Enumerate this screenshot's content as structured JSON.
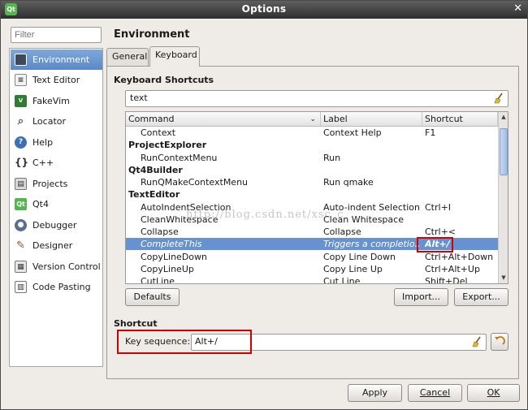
{
  "window": {
    "title": "Options"
  },
  "filter": {
    "placeholder": "Filter"
  },
  "sidebar": {
    "items": [
      {
        "label": "Environment",
        "icon": "monitor-icon",
        "selected": true
      },
      {
        "label": "Text Editor",
        "icon": "text-editor-icon"
      },
      {
        "label": "FakeVim",
        "icon": "fakevim-icon"
      },
      {
        "label": "Locator",
        "icon": "magnifier-icon"
      },
      {
        "label": "Help",
        "icon": "help-icon"
      },
      {
        "label": "C++",
        "icon": "braces-icon"
      },
      {
        "label": "Projects",
        "icon": "projects-icon"
      },
      {
        "label": "Qt4",
        "icon": "qt-icon"
      },
      {
        "label": "Debugger",
        "icon": "debugger-icon"
      },
      {
        "label": "Designer",
        "icon": "designer-icon"
      },
      {
        "label": "Version Control",
        "icon": "version-control-icon"
      },
      {
        "label": "Code Pasting",
        "icon": "clipboard-icon"
      }
    ]
  },
  "page": {
    "title": "Environment",
    "tabs": [
      {
        "label": "General"
      },
      {
        "label": "Keyboard",
        "active": true
      }
    ]
  },
  "shortcuts": {
    "header": "Keyboard Shortcuts",
    "search_value": "text",
    "columns": [
      "Command",
      "Label",
      "Shortcut"
    ],
    "rows": [
      {
        "command": "Context",
        "label": "Context Help",
        "shortcut": "F1"
      },
      {
        "command": "ProjectExplorer",
        "group": true
      },
      {
        "command": "RunContextMenu",
        "label": "Run",
        "shortcut": ""
      },
      {
        "command": "Qt4Builder",
        "group": true
      },
      {
        "command": "RunQMakeContextMenu",
        "label": "Run qmake",
        "shortcut": ""
      },
      {
        "command": "TextEditor",
        "group": true
      },
      {
        "command": "AutoIndentSelection",
        "label": "Auto-indent Selection",
        "shortcut": "Ctrl+I"
      },
      {
        "command": "CleanWhitespace",
        "label": "Clean Whitespace",
        "shortcut": ""
      },
      {
        "command": "Collapse",
        "label": "Collapse",
        "shortcut": "Ctrl+<"
      },
      {
        "command": "CompleteThis",
        "label": "Triggers a completio...",
        "shortcut": "Alt+/",
        "selected": true
      },
      {
        "command": "CopyLineDown",
        "label": "Copy Line Down",
        "shortcut": "Ctrl+Alt+Down"
      },
      {
        "command": "CopyLineUp",
        "label": "Copy Line Up",
        "shortcut": "Ctrl+Alt+Up"
      },
      {
        "command": "CutLine",
        "label": "Cut Line",
        "shortcut": "Shift+Del"
      }
    ],
    "defaults_label": "Defaults",
    "import_label": "Import...",
    "export_label": "Export..."
  },
  "shortcut_section": {
    "header": "Shortcut",
    "key_sequence_label": "Key sequence:",
    "key_sequence_value": "Alt+/"
  },
  "footer": {
    "apply_label": "Apply",
    "cancel_label": "Cancel",
    "ok_label": "OK"
  },
  "watermark": "http://blog.csdn.net/xsc_c",
  "colors": {
    "selection": "#6692cf",
    "highlight_box": "#d40000",
    "titlebar": "#3a3a3a"
  }
}
